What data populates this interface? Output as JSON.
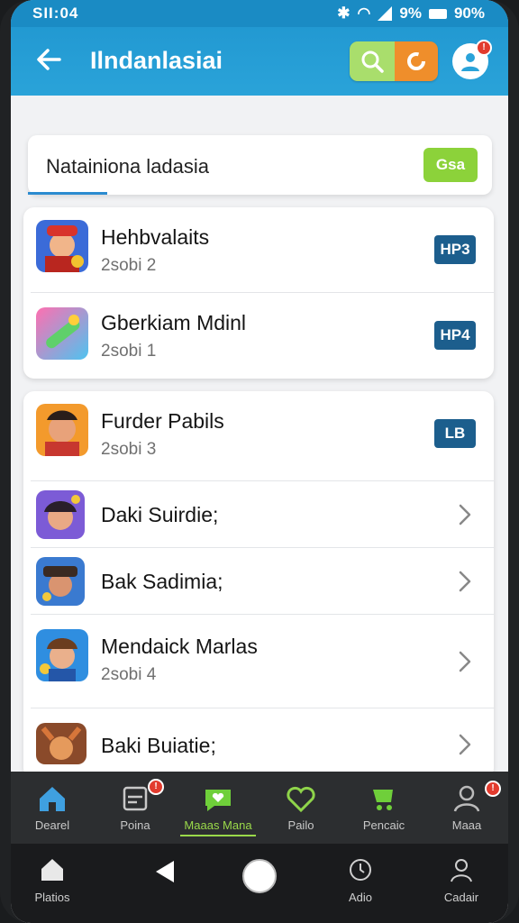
{
  "status_bar": {
    "time": "SII:04",
    "battery_text": "9%",
    "battery_pct": "90%"
  },
  "app_bar": {
    "title": "Ilndanlasiai"
  },
  "search": {
    "text": "Natainiona ladasia",
    "button_label": "Gsa"
  },
  "group1": [
    {
      "name": "Hehbvalaits",
      "sub": "2sobi 2",
      "badge": "HP3",
      "icon": "app-icon-fireman"
    },
    {
      "name": "Gberkiam Mdinl",
      "sub": "2sobi 1",
      "badge": "HP4",
      "icon": "app-icon-candy"
    }
  ],
  "group2": [
    {
      "name": "Furder Pabils",
      "sub": "2sobi 3",
      "badge": "LB",
      "icon": "app-icon-hero"
    },
    {
      "name": "Daki Suirdie;",
      "sub": "",
      "chevron": true,
      "icon": "app-icon-girl"
    },
    {
      "name": "Bak Sadimia;",
      "sub": "",
      "chevron": true,
      "icon": "app-icon-pirate"
    },
    {
      "name": "Mendaick Marlas",
      "sub": "2sobi 4",
      "chevron": true,
      "icon": "app-icon-boy"
    },
    {
      "name": "Baki Buiatie;",
      "sub": "",
      "chevron": true,
      "icon": "app-icon-fox"
    }
  ],
  "bottom_nav": [
    {
      "label": "Dearel",
      "icon": "home-icon",
      "badge": ""
    },
    {
      "label": "Poina",
      "icon": "inbox-icon",
      "badge": "!"
    },
    {
      "label": "Maaas Mana",
      "icon": "chat-heart-icon",
      "active": true
    },
    {
      "label": "Pailo",
      "icon": "heart-icon"
    },
    {
      "label": "Pencaic",
      "icon": "cart-icon"
    },
    {
      "label": "Maaa",
      "icon": "user-icon",
      "badge": "!"
    }
  ],
  "system_nav": [
    {
      "label": "Platios",
      "icon": "home-icon"
    },
    {
      "label": "",
      "icon": "back-triangle-icon"
    },
    {
      "label": "",
      "icon": "home-circle-icon"
    },
    {
      "label": "Adio",
      "icon": "clock-icon"
    },
    {
      "label": "Cadair",
      "icon": "person-icon"
    }
  ],
  "colors": {
    "app_bar": "#2aa3d9",
    "accent_green": "#8cd23a",
    "badge_blue": "#1c5e8d",
    "nav_bg": "#2c2e30"
  }
}
